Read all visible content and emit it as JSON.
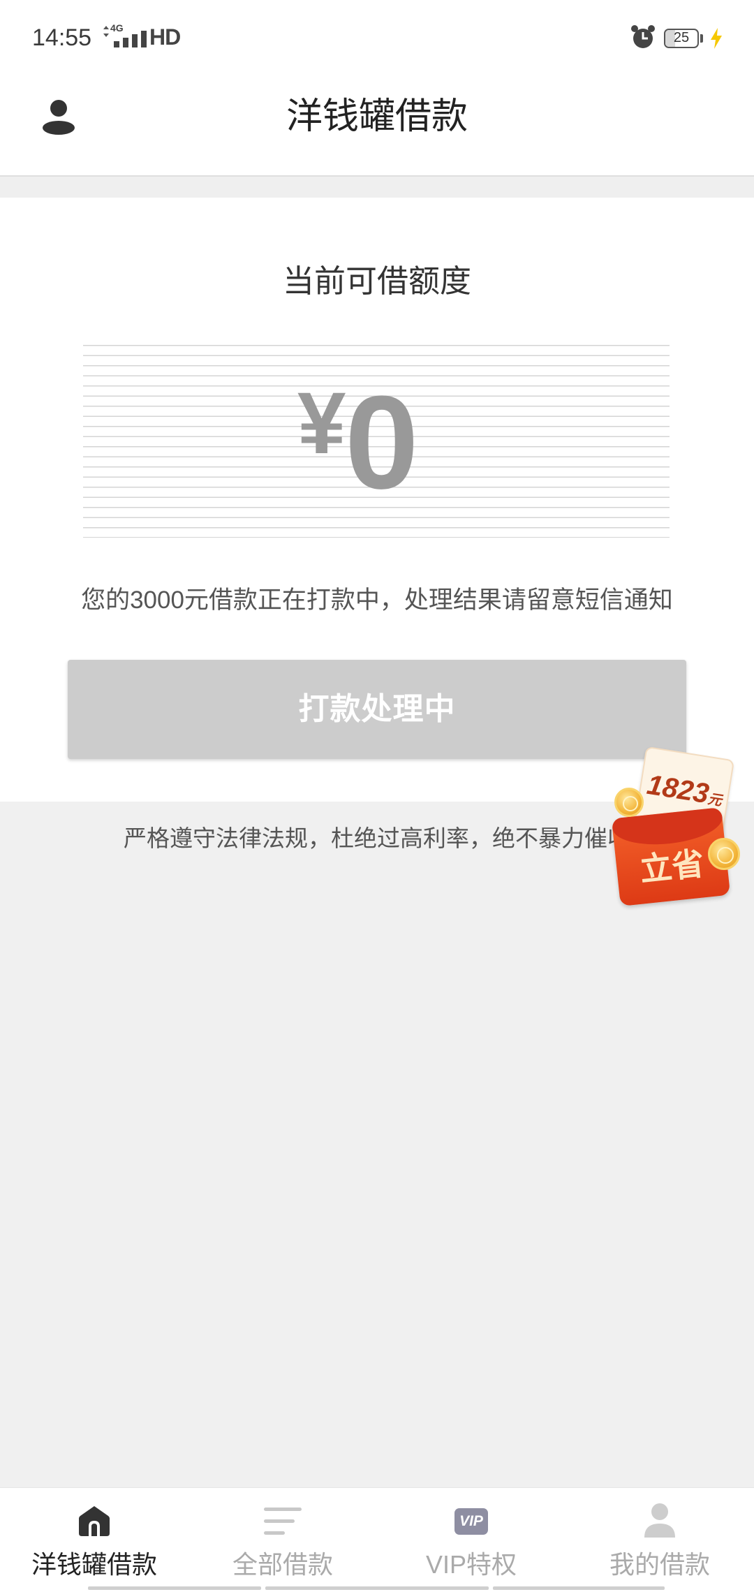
{
  "status_bar": {
    "time": "14:55",
    "network_type": "4G",
    "hd_label": "HD",
    "battery_level": "25",
    "icons": [
      "data-arrows-icon",
      "signal-icon",
      "alarm-icon",
      "battery-icon",
      "charging-bolt-icon"
    ]
  },
  "header": {
    "title": "洋钱罐借款",
    "profile_icon": "person-icon"
  },
  "credit_card": {
    "label": "当前可借额度",
    "currency_symbol": "¥",
    "amount": "0",
    "status_message": "您的3000元借款正在打款中，处理结果请留意短信通知",
    "button_label": "打款处理中",
    "button_disabled": true
  },
  "disclaimer": "严格遵守法律法规，杜绝过高利率，绝不暴力催收",
  "promo_badge": {
    "amount": "1823",
    "unit": "元",
    "label": "立省",
    "icon": "red-envelope-icon"
  },
  "bottom_nav": {
    "items": [
      {
        "label": "洋钱罐借款",
        "icon": "home-icon",
        "active": true
      },
      {
        "label": "全部借款",
        "icon": "list-icon",
        "active": false
      },
      {
        "label": "VIP特权",
        "icon": "vip-icon",
        "icon_text": "VIP",
        "active": false
      },
      {
        "label": "我的借款",
        "icon": "person-icon",
        "active": false
      }
    ]
  },
  "colors": {
    "background": "#f0f0f0",
    "card": "#ffffff",
    "amount_text": "#999999",
    "button_disabled": "#cccccc",
    "nav_active": "#222222",
    "nav_inactive": "#aaaaaa",
    "promo_red": "#f4622a",
    "charging": "#f6c800"
  }
}
